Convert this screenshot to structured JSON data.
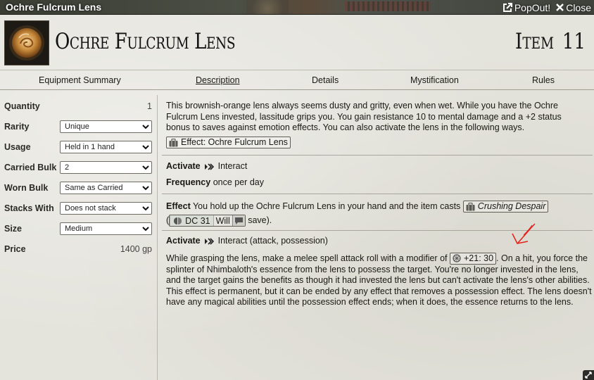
{
  "window": {
    "title": "Ochre Fulcrum Lens",
    "popout_label": "PopOut!",
    "close_label": "Close"
  },
  "header": {
    "name": "Ochre Fulcrum Lens",
    "level_label": "Item",
    "level_value": "11",
    "image_icon": "ochre-lens-icon"
  },
  "tabs": [
    {
      "label": "Equipment Summary",
      "active": false
    },
    {
      "label": "Description",
      "active": true
    },
    {
      "label": "Details",
      "active": false
    },
    {
      "label": "Mystification",
      "active": false
    },
    {
      "label": "Rules",
      "active": false
    }
  ],
  "sidebar": {
    "quantity": {
      "label": "Quantity",
      "value": "1"
    },
    "rarity": {
      "label": "Rarity",
      "value": "Unique"
    },
    "usage": {
      "label": "Usage",
      "value": "Held in 1 hand"
    },
    "carried_bulk": {
      "label": "Carried Bulk",
      "value": "2"
    },
    "worn_bulk": {
      "label": "Worn Bulk",
      "value": "Same as Carried"
    },
    "stacks_with": {
      "label": "Stacks With",
      "value": "Does not stack"
    },
    "size": {
      "label": "Size",
      "value": "Medium"
    },
    "price": {
      "label": "Price",
      "value": "1400 gp"
    }
  },
  "description": {
    "intro": "This brownish-orange lens always seems dusty and gritty, even when wet. While you have the Ochre Fulcrum Lens invested, lassitude grips you. You gain resistance 10 to mental damage and a +2 status bonus to saves against emotion effects. You can also activate the lens in the following ways.",
    "effect_link": "Effect: Ochre Fulcrum Lens",
    "activate1_label": "Activate",
    "activate1_action": "Interact",
    "frequency_label": "Frequency",
    "frequency_value": "once per day",
    "effect_label": "Effect",
    "effect_text": "You hold up the Ochre Fulcrum Lens in your hand and the item casts",
    "spell_link": "Crushing Despair",
    "open_paren": "(",
    "dc_text": "DC 31",
    "save_type": "Will",
    "save_tail": "save).",
    "activate2_label": "Activate",
    "activate2_action": "Interact (attack, possession)",
    "possession_pre": "While grasping the lens, make a melee spell attack roll with a modifier of",
    "attack_mod": "+21: 30",
    "possession_post": ". On a hit, you force the splinter of Nhimbaloth's essence from the lens to possess the target. You're no longer invested in the lens, and the target gains the benefits as though it had invested the lens but can't activate the lens's other abilities. This effect is permanent, but it can be ended by any effect that removes a possession effect. The lens doesn't have any magical abilities until the possession effect ends; when it does, the essence returns to the lens."
  },
  "colors": {
    "annotation": "#e3201b",
    "background": "#e4e3dc"
  }
}
